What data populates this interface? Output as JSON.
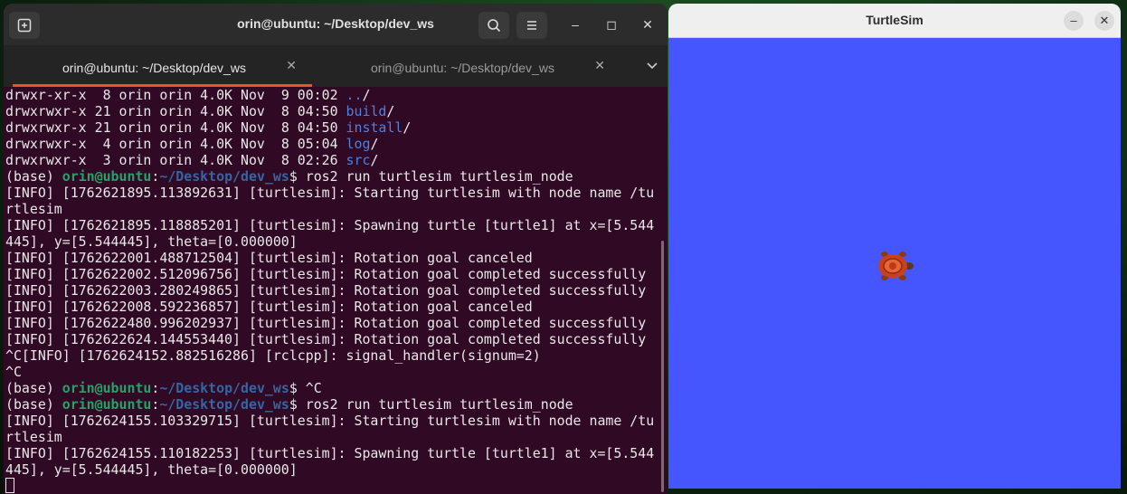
{
  "terminal": {
    "title": "orin@ubuntu: ~/Desktop/dev_ws",
    "tabs": [
      {
        "label": "orin@ubuntu: ~/Desktop/dev_ws"
      },
      {
        "label": "orin@ubuntu: ~/Desktop/dev_ws"
      }
    ],
    "lines": [
      {
        "type": "ls",
        "perm": "drwxr-xr-x",
        "meta": "  8 orin orin 4.0K Nov  9 00:02 ",
        "name": "..",
        "suffix": "/"
      },
      {
        "type": "ls",
        "perm": "drwxrwxr-x",
        "meta": " 21 orin orin 4.0K Nov  8 04:50 ",
        "name": "build",
        "suffix": "/"
      },
      {
        "type": "ls",
        "perm": "drwxrwxr-x",
        "meta": " 21 orin orin 4.0K Nov  8 04:50 ",
        "name": "install",
        "suffix": "/"
      },
      {
        "type": "ls",
        "perm": "drwxrwxr-x",
        "meta": "  4 orin orin 4.0K Nov  8 05:04 ",
        "name": "log",
        "suffix": "/"
      },
      {
        "type": "ls",
        "perm": "drwxrwxr-x",
        "meta": "  3 orin orin 4.0K Nov  8 02:26 ",
        "name": "src",
        "suffix": "/"
      },
      {
        "type": "prompt",
        "env": "(base) ",
        "user": "orin@ubuntu",
        "path": "~/Desktop/dev_ws",
        "cmd": "$ ros2 run turtlesim turtlesim_node"
      },
      {
        "type": "text",
        "text": "[INFO] [1762621895.113892631] [turtlesim]: Starting turtlesim with node name /tu"
      },
      {
        "type": "text",
        "text": "rtlesim"
      },
      {
        "type": "text",
        "text": "[INFO] [1762621895.118885201] [turtlesim]: Spawning turtle [turtle1] at x=[5.544"
      },
      {
        "type": "text",
        "text": "445], y=[5.544445], theta=[0.000000]"
      },
      {
        "type": "text",
        "text": "[INFO] [1762622001.488712504] [turtlesim]: Rotation goal canceled"
      },
      {
        "type": "text",
        "text": "[INFO] [1762622002.512096756] [turtlesim]: Rotation goal completed successfully"
      },
      {
        "type": "text",
        "text": "[INFO] [1762622003.280249865] [turtlesim]: Rotation goal completed successfully"
      },
      {
        "type": "text",
        "text": "[INFO] [1762622008.592236857] [turtlesim]: Rotation goal canceled"
      },
      {
        "type": "text",
        "text": "[INFO] [1762622480.996202937] [turtlesim]: Rotation goal completed successfully"
      },
      {
        "type": "text",
        "text": "[INFO] [1762622624.144553440] [turtlesim]: Rotation goal completed successfully"
      },
      {
        "type": "text",
        "text": "^C[INFO] [1762624152.882516286] [rclcpp]: signal_handler(signum=2)"
      },
      {
        "type": "text",
        "text": "^C"
      },
      {
        "type": "prompt",
        "env": "(base) ",
        "user": "orin@ubuntu",
        "path": "~/Desktop/dev_ws",
        "cmd": "$ ^C"
      },
      {
        "type": "prompt",
        "env": "(base) ",
        "user": "orin@ubuntu",
        "path": "~/Desktop/dev_ws",
        "cmd": "$ ros2 run turtlesim turtlesim_node"
      },
      {
        "type": "text",
        "text": "[INFO] [1762624155.103329715] [turtlesim]: Starting turtlesim with node name /tu"
      },
      {
        "type": "text",
        "text": "rtlesim"
      },
      {
        "type": "text",
        "text": "[INFO] [1762624155.110182253] [turtlesim]: Spawning turtle [turtle1] at x=[5.544"
      },
      {
        "type": "text",
        "text": "445], y=[5.544445], theta=[0.000000]"
      },
      {
        "type": "cursor"
      }
    ]
  },
  "turtlesim": {
    "title": "TurtleSim",
    "background_color": "#4556ff"
  }
}
